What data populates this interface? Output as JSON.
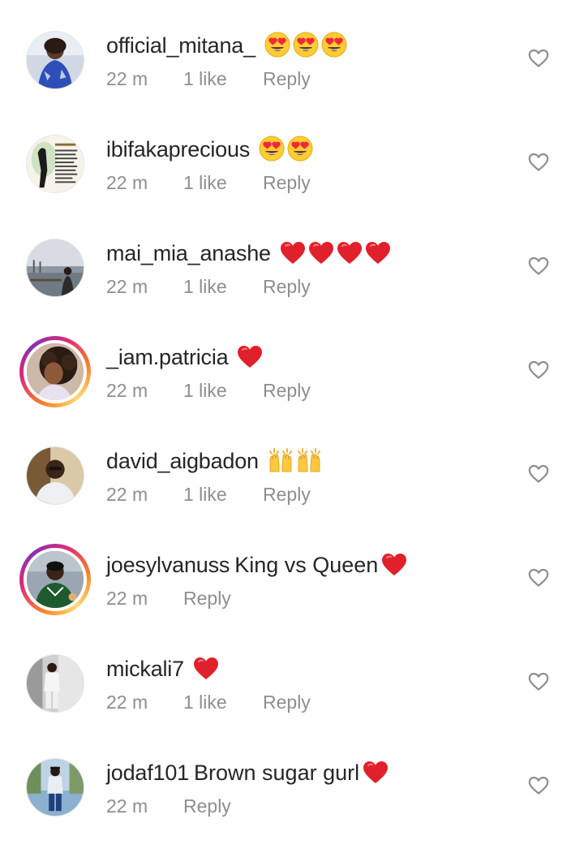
{
  "comments": [
    {
      "username": "official_mitana_",
      "text": "",
      "emoji": [
        "heart-eyes",
        "heart-eyes",
        "heart-eyes"
      ],
      "time": "22 m",
      "likes": "1 like",
      "reply": "Reply",
      "story_ring": false,
      "avatar": "woman-blue-dress"
    },
    {
      "username": "ibifakaprecious",
      "text": "",
      "emoji": [
        "heart-eyes",
        "heart-eyes"
      ],
      "time": "22 m",
      "likes": "1 like",
      "reply": "Reply",
      "story_ring": false,
      "avatar": "text-card"
    },
    {
      "username": "mai_mia_anashe",
      "text": "",
      "emoji": [
        "red-heart",
        "red-heart",
        "red-heart",
        "red-heart"
      ],
      "time": "22 m",
      "likes": "1 like",
      "reply": "Reply",
      "story_ring": false,
      "avatar": "waterfront"
    },
    {
      "username": "_iam.patricia",
      "text": "",
      "emoji": [
        "red-heart"
      ],
      "time": "22 m",
      "likes": "1 like",
      "reply": "Reply",
      "story_ring": true,
      "avatar": "curly-hair"
    },
    {
      "username": "david_aigbadon",
      "text": "",
      "emoji": [
        "raising-hands",
        "raising-hands"
      ],
      "time": "22 m",
      "likes": "1 like",
      "reply": "Reply",
      "story_ring": false,
      "avatar": "man-white-shirt"
    },
    {
      "username": "joesylvanuss",
      "text": "King vs Queen",
      "emoji": [
        "red-heart"
      ],
      "time": "22 m",
      "likes": "",
      "reply": "Reply",
      "story_ring": true,
      "avatar": "man-green-jersey"
    },
    {
      "username": "mickali7",
      "text": "",
      "emoji": [
        "red-heart"
      ],
      "time": "22 m",
      "likes": "1 like",
      "reply": "Reply",
      "story_ring": false,
      "avatar": "man-white-outfit"
    },
    {
      "username": "jodaf101",
      "text": "Brown sugar gurl",
      "emoji": [
        "red-heart"
      ],
      "time": "22 m",
      "likes": "",
      "reply": "Reply",
      "story_ring": false,
      "avatar": "man-standing-outdoor"
    }
  ],
  "colors": {
    "username": "#262626",
    "meta": "#8e8e8e",
    "heart_outline": "#8e8e8e",
    "red_heart": "#e0202b",
    "emoji_yellow": "#ffcc33"
  }
}
